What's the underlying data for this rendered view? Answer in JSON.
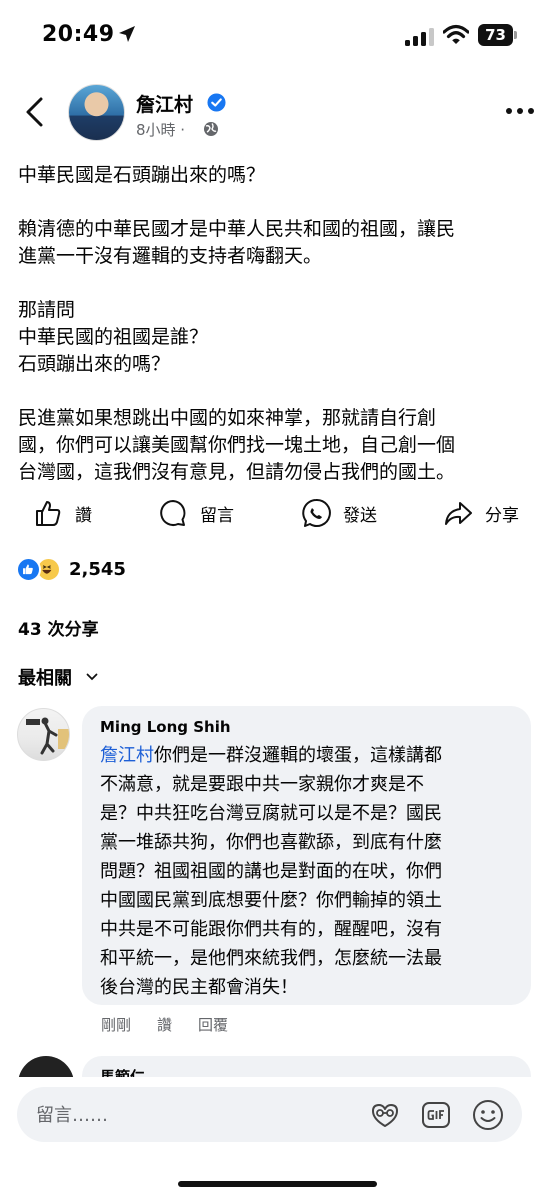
{
  "status_bar": {
    "time": "20:49",
    "battery": "73"
  },
  "post": {
    "author": "詹江村",
    "time": "8小時 ·",
    "paragraphs": [
      [
        "中華民國是石頭蹦出來的嗎？"
      ],
      [
        "賴清德的中華民國才是中華人民共和國的祖國，讓民",
        "進黨一干沒有邏輯的支持者嗨翻天。"
      ],
      [
        "那請問",
        "中華民國的祖國是誰？",
        "石頭蹦出來的嗎？"
      ],
      [
        "民進黨如果想跳出中國的如來神掌，那就請自行創",
        "國，你們可以讓美國幫你們找一塊土地，自己創一個",
        "台灣國，這我們沒有意見，但請勿侵占我們的國土。"
      ]
    ]
  },
  "actions": {
    "like": "讚",
    "comment": "留言",
    "send": "發送",
    "share": "分享"
  },
  "reactions": {
    "count": "2,545"
  },
  "shares": "43 次分享",
  "sort_label": "最相關",
  "comment": {
    "author": "Ming Long Shih",
    "mention": "詹江村",
    "lines": [
      "你們是一群沒邏輯的壞蛋，這樣講都",
      "不滿意，就是要跟中共一家親你才爽是不",
      "是？中共狂吃台灣豆腐就可以是不是？國民",
      "黨一堆舔共狗，你們也喜歡舔，到底有什麼",
      "問題？祖國祖國的講也是對面的在吠，你們",
      "中國國民黨到底想要什麼？你們輸掉的領土",
      "中共是不可能跟你們共有的，醒醒吧，沒有",
      "和平統一，是他們來統我們，怎麼統一法最",
      "後台灣的民主都會消失！"
    ],
    "time": "剛剛",
    "like": "讚",
    "reply": "回覆"
  },
  "next_comment": {
    "author": "馬範仁"
  },
  "composer": {
    "placeholder": "留言……"
  },
  "colors": {
    "link": "#1d5fd6",
    "verified": "#1877f2",
    "bubble": "#f0f2f5",
    "secondary_text": "#65676b"
  }
}
